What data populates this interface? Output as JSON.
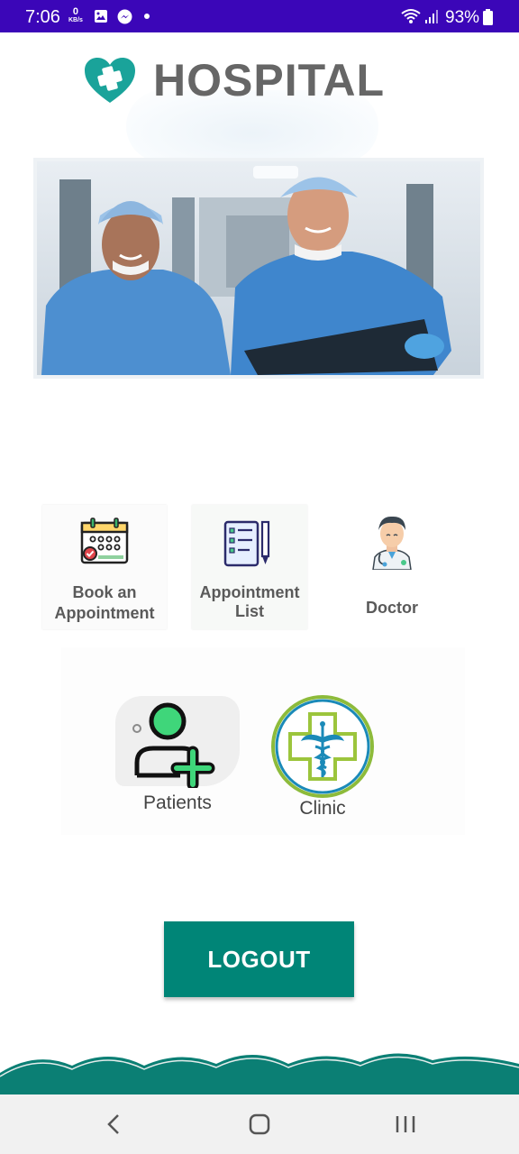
{
  "status_bar": {
    "time": "7:06",
    "data_rate_value": "0",
    "data_rate_unit": "KB/s",
    "battery_percent": "93%",
    "icons": [
      "gallery-icon",
      "messenger-icon",
      "wifi-icon",
      "signal-icon",
      "battery-icon"
    ]
  },
  "header": {
    "title": "HOSPITAL",
    "logo_icon": "heart-cross-icon",
    "accent_color": "#1aa39a"
  },
  "hero": {
    "image": "two-surgeons-in-scrubs-photo"
  },
  "menu": {
    "items": [
      {
        "id": "book",
        "label_line1": "Book an",
        "label_line2": "Appointment",
        "icon": "calendar-icon"
      },
      {
        "id": "list",
        "label_line1": "Appointment",
        "label_line2": "List",
        "icon": "checklist-icon"
      },
      {
        "id": "doctor",
        "label": "Doctor",
        "icon": "doctor-icon"
      },
      {
        "id": "patients",
        "label": "Patients",
        "icon": "add-user-icon"
      },
      {
        "id": "clinic",
        "label": "Clinic",
        "icon": "caduceus-cross-icon"
      }
    ]
  },
  "logout": {
    "label": "LOGOUT",
    "color": "#008577"
  },
  "nav_bar": {
    "buttons": [
      "back-icon",
      "home-icon",
      "recents-icon"
    ]
  }
}
